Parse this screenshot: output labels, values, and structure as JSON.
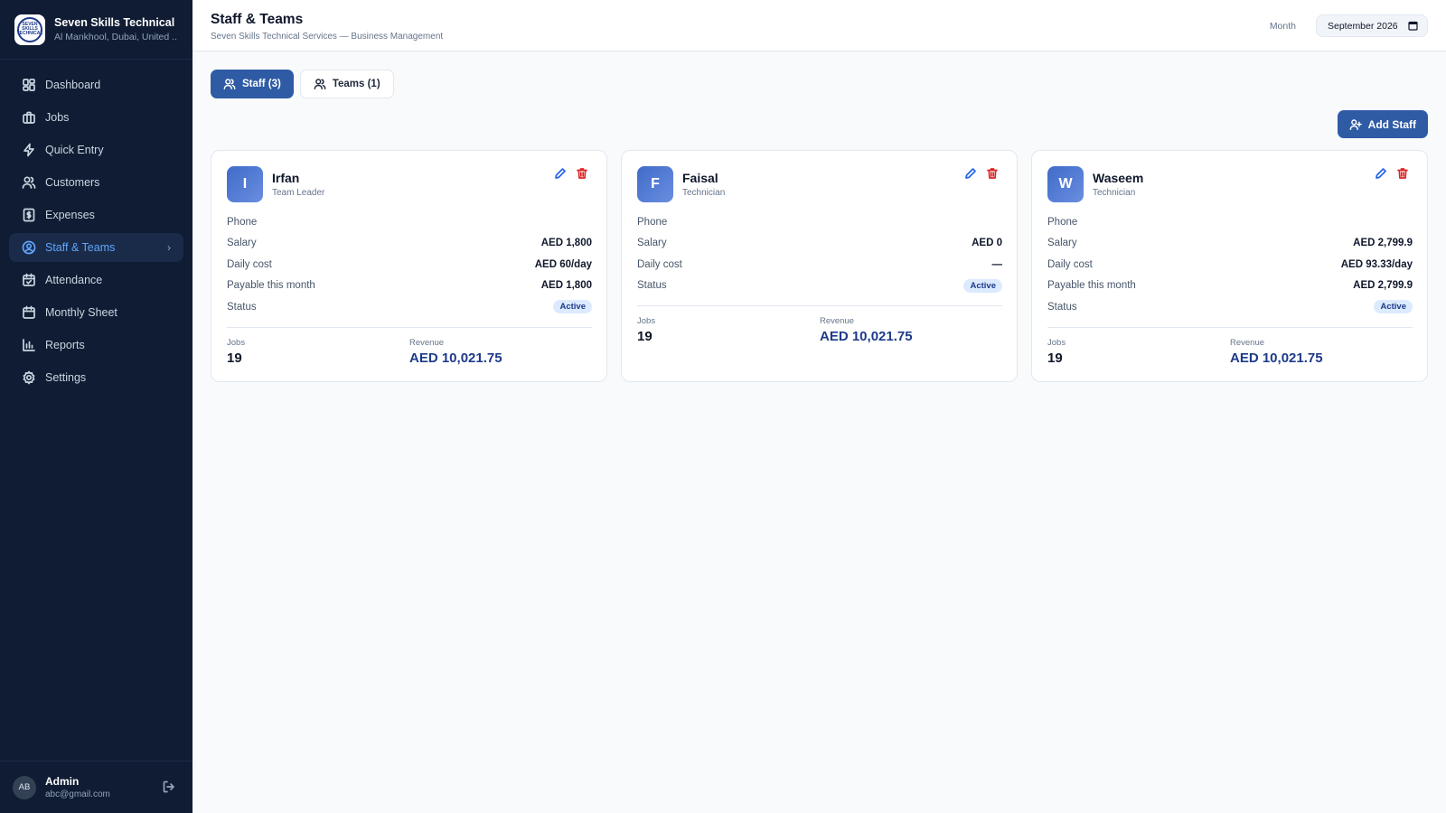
{
  "brand": {
    "name": "Seven Skills Technical ...",
    "location": "Al Mankhool, Dubai, United ...",
    "logo_text": "SEVEN SKILLS TECHNICAL"
  },
  "sidebar": {
    "items": [
      {
        "label": "Dashboard",
        "icon": "dashboard-icon"
      },
      {
        "label": "Jobs",
        "icon": "briefcase-icon"
      },
      {
        "label": "Quick Entry",
        "icon": "lightning-icon"
      },
      {
        "label": "Customers",
        "icon": "users-icon"
      },
      {
        "label": "Expenses",
        "icon": "receipt-icon"
      },
      {
        "label": "Staff & Teams",
        "icon": "user-circle-icon",
        "active": true
      },
      {
        "label": "Attendance",
        "icon": "calendar-check-icon"
      },
      {
        "label": "Monthly Sheet",
        "icon": "calendar-icon"
      },
      {
        "label": "Reports",
        "icon": "bar-chart-icon"
      },
      {
        "label": "Settings",
        "icon": "gear-icon"
      }
    ]
  },
  "user": {
    "initials": "AB",
    "name": "Admin",
    "email": "abc@gmail.com"
  },
  "header": {
    "title": "Staff & Teams",
    "subtitle": "Seven Skills Technical Services — Business Management",
    "month_label": "Month",
    "month_value": "September  2026"
  },
  "tabs": [
    {
      "label": "Staff (3)",
      "active": true
    },
    {
      "label": "Teams (1)",
      "active": false
    }
  ],
  "actions": {
    "add_staff": "Add Staff"
  },
  "labels": {
    "phone": "Phone",
    "salary": "Salary",
    "daily_cost": "Daily cost",
    "payable": "Payable this month",
    "status": "Status",
    "jobs": "Jobs",
    "revenue": "Revenue"
  },
  "staff": [
    {
      "initial": "I",
      "name": "Irfan",
      "role": "Team Leader",
      "phone": "",
      "salary": "AED 1,800",
      "daily_cost": "AED 60/day",
      "payable": "AED 1,800",
      "status": "Active",
      "jobs": "19",
      "revenue": "AED 10,021.75"
    },
    {
      "initial": "F",
      "name": "Faisal",
      "role": "Technician",
      "phone": "",
      "salary": "AED 0",
      "daily_cost": "—",
      "status": "Active",
      "jobs": "19",
      "revenue": "AED 10,021.75"
    },
    {
      "initial": "W",
      "name": "Waseem",
      "role": "Technician",
      "phone": "",
      "salary": "AED 2,799.9",
      "daily_cost": "AED 93.33/day",
      "payable": "AED 2,799.9",
      "status": "Active",
      "jobs": "19",
      "revenue": "AED 10,021.75"
    }
  ],
  "colors": {
    "sidebar_bg": "#0f1c33",
    "accent": "#2f5ba5",
    "active_nav": "#60a5fa",
    "badge_bg": "#dbeafe",
    "delete": "#dc2626"
  }
}
